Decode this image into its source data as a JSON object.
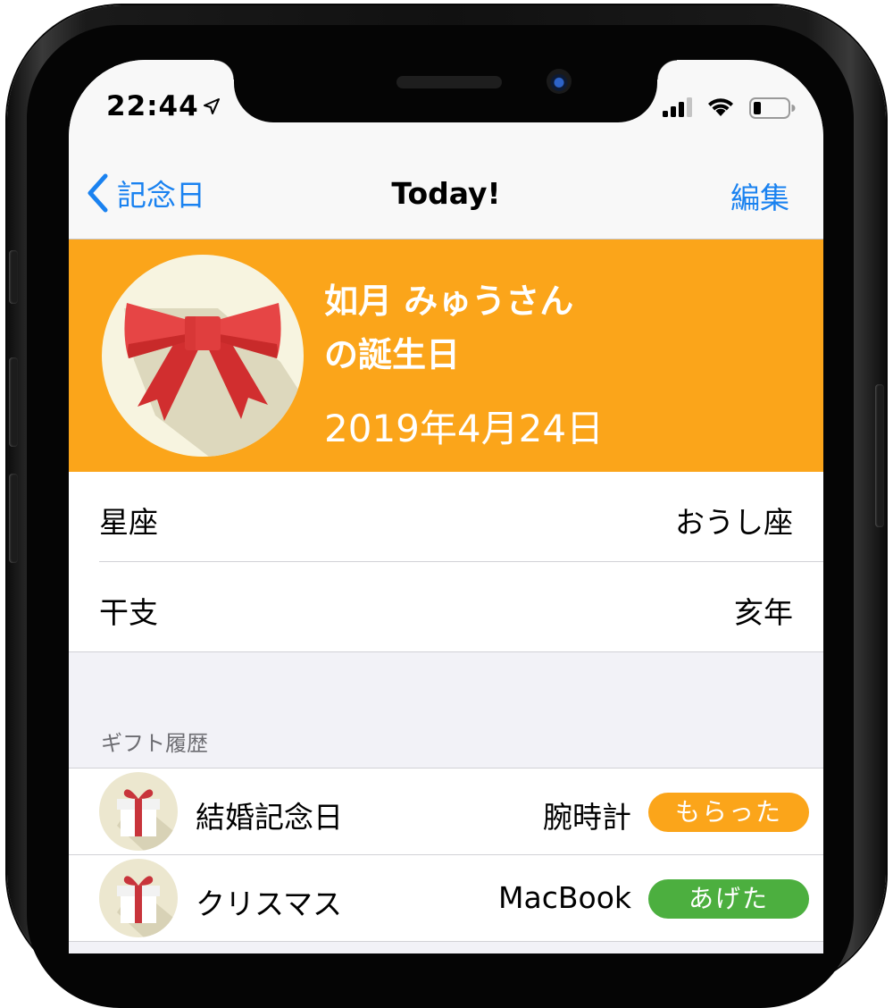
{
  "status_bar": {
    "time": "22:44",
    "icons": [
      "location-arrow-icon",
      "cellular-signal-icon",
      "wifi-icon",
      "battery-icon"
    ]
  },
  "nav": {
    "back_label": "記念日",
    "title": "Today!",
    "edit_label": "編集"
  },
  "hero": {
    "icon": "ribbon-bow-icon",
    "name": "如月 みゅうさん",
    "subtitle": "の誕生日",
    "date": "2019年4月24日",
    "background_color": "#fba51a"
  },
  "info_rows": [
    {
      "label": "星座",
      "value": "おうし座"
    },
    {
      "label": "干支",
      "value": "亥年"
    }
  ],
  "gift_section": {
    "header": "ギフト履歴",
    "items": [
      {
        "icon": "gift-box-icon",
        "title": "結婚記念日",
        "item": "腕時計",
        "badge": "もらった",
        "badge_color": "#fba51a"
      },
      {
        "icon": "gift-box-icon",
        "title": "クリスマス",
        "item": "MacBook",
        "badge": "あげた",
        "badge_color": "#4caf3f"
      }
    ]
  },
  "colors": {
    "accent_blue": "#1a82f0",
    "orange": "#fba51a",
    "green": "#4caf3f"
  }
}
